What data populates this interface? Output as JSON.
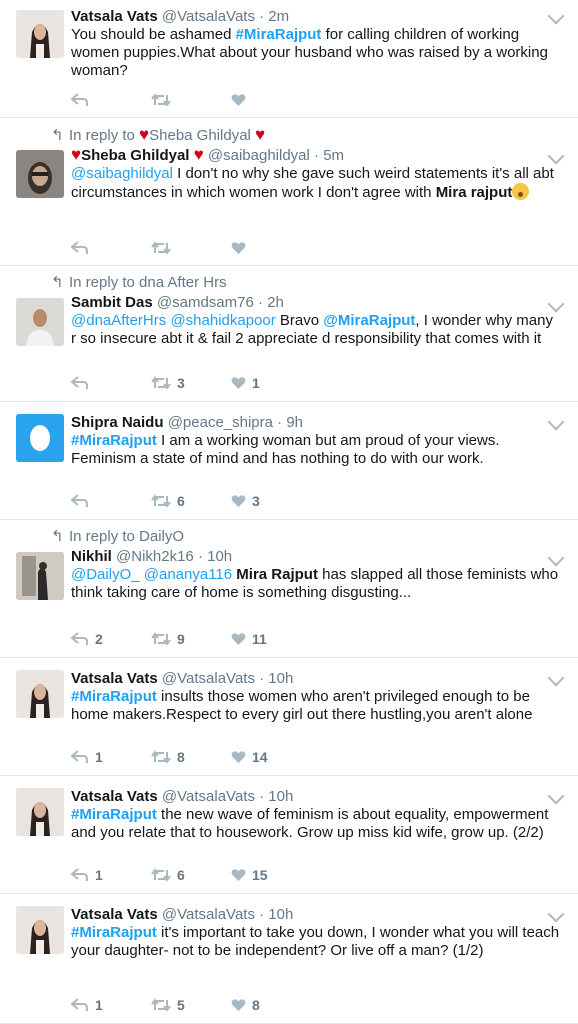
{
  "tweets": [
    {
      "name": "Vatsala Vats",
      "handle": "@VatsalaVats",
      "time": "2m",
      "text_parts": [
        "You should be ashamed ",
        "#MiraRajput",
        " for calling children of working women puppies.What about your husband who was raised by a working woman?"
      ],
      "replies": "",
      "retweets": "",
      "likes": ""
    },
    {
      "reply_to": "In reply to",
      "reply_name": "Sheba Ghildyal",
      "name": "Sheba Ghildyal",
      "handle": "@saibaghildyal",
      "time": "5m",
      "text_parts": [
        "@saibaghildyal",
        " I don't no why she gave such weird statements it's all abt circumstances in which women work I don't  agree with ",
        "Mira rajput"
      ],
      "replies": "",
      "retweets": "",
      "likes": ""
    },
    {
      "reply_to": "In reply to dna After Hrs",
      "name": "Sambit Das",
      "handle": "@samdsam76",
      "time": "2h",
      "text_parts": [
        "@dnaAfterHrs",
        " ",
        "@shahidkapoor",
        " Bravo ",
        "@MiraRajput",
        ", I wonder why many r so insecure abt it & fail 2 appreciate d responsibility that comes with it"
      ],
      "replies": "",
      "retweets": "3",
      "likes": "1"
    },
    {
      "name": "Shipra Naidu",
      "handle": "@peace_shipra",
      "time": "9h",
      "text_parts": [
        "#MiraRajput",
        " I am a working woman but am proud of your views. Feminism a state of mind and has nothing to do with our work."
      ],
      "replies": "",
      "retweets": "6",
      "likes": "3"
    },
    {
      "reply_to": "In reply to DailyO",
      "name": "Nikhil",
      "handle": "@Nikh2k16",
      "time": "10h",
      "text_parts": [
        "@DailyO_",
        " ",
        "@ananya116",
        " ",
        "Mira Rajput",
        " has slapped all those feminists who think taking care of home is something disgusting..."
      ],
      "replies": "2",
      "retweets": "9",
      "likes": "11"
    },
    {
      "name": "Vatsala Vats",
      "handle": "@VatsalaVats",
      "time": "10h",
      "text_parts": [
        "#MiraRajput",
        " insults those women who aren't privileged enough to be home makers.Respect to every girl out there hustling,you aren't alone"
      ],
      "replies": "1",
      "retweets": "8",
      "likes": "14"
    },
    {
      "name": "Vatsala Vats",
      "handle": "@VatsalaVats",
      "time": "10h",
      "text_parts": [
        "#MiraRajput",
        " the new wave of feminism is about equality, empowerment and you relate that to housework. Grow up miss kid wife, grow up. (2/2)"
      ],
      "replies": "1",
      "retweets": "6",
      "likes": "15"
    },
    {
      "name": "Vatsala Vats",
      "handle": "@VatsalaVats",
      "time": "10h",
      "text_parts": [
        "#MiraRajput",
        " it's important to take you down, I wonder what you will teach your daughter- not to be independent? Or live off a man? (1/2)"
      ],
      "replies": "1",
      "retweets": "5",
      "likes": "8"
    }
  ],
  "sep": " · ",
  "colors": {
    "link": "#1da1f2",
    "muted": "#657786",
    "heart": "#d0021b"
  }
}
